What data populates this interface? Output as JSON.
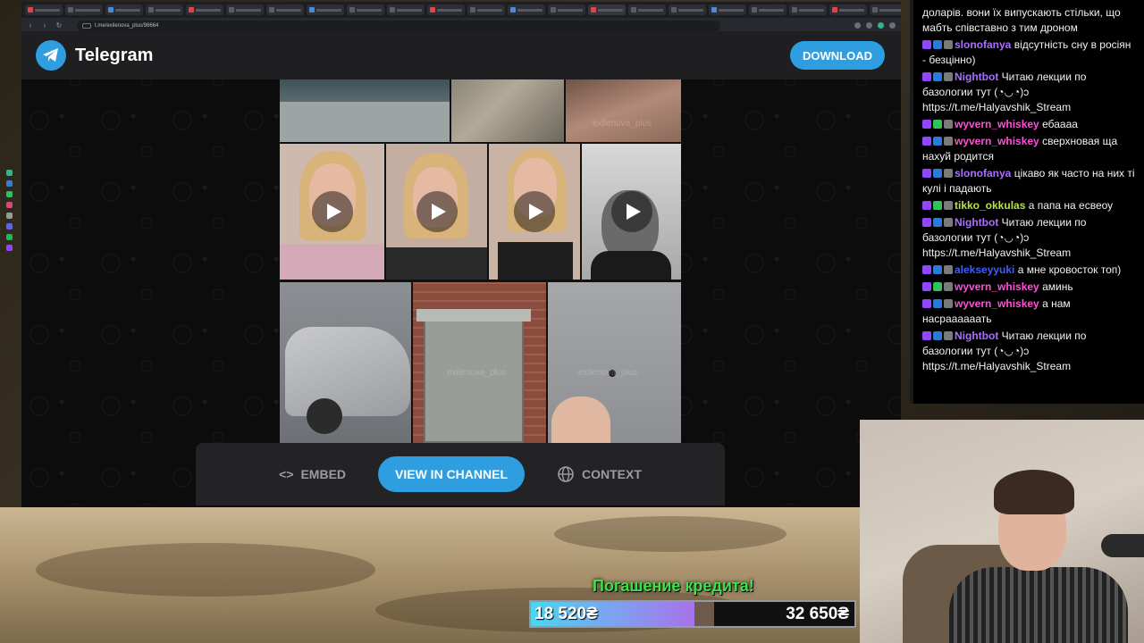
{
  "browser": {
    "url": "t.me/exilenova_plus/98664",
    "tab_count": 30
  },
  "telegram": {
    "brand": "Telegram",
    "download_label": "DOWNLOAD",
    "watermark": "exilenova_plus",
    "actions": {
      "embed_label": "EMBED",
      "view_label": "VIEW IN CHANNEL",
      "context_label": "CONTEXT"
    }
  },
  "chat": {
    "messages": [
      {
        "user": "",
        "color": "#ffffff",
        "text": "доларів. вони їх випускають стільки, що мабть співставно з тим дроном"
      },
      {
        "user": "slonofanya",
        "color": "#a970ff",
        "text": "відсутність сну в росіян - безцінно)"
      },
      {
        "user": "Nightbot",
        "color": "#a970ff",
        "text": "Читаю лекции по базологии тут (◔◡◔)ɔ https://t.me/Halyavshik_Stream"
      },
      {
        "user": "wyvern_whiskey",
        "color": "#ff4fd8",
        "text": "ебаааа"
      },
      {
        "user": "wyvern_whiskey",
        "color": "#ff4fd8",
        "text": "сверхновая ща нахуй родится"
      },
      {
        "user": "slonofanya",
        "color": "#a970ff",
        "text": "цікаво як часто на них ті кулі і падають"
      },
      {
        "user": "tikko_okkulas",
        "color": "#b7e34a",
        "text": "а папа на есвеоу"
      },
      {
        "user": "Nightbot",
        "color": "#a970ff",
        "text": "Читаю лекции по базологии тут (◔◡◔)ɔ https://t.me/Halyavshik_Stream"
      },
      {
        "user": "alekseyyuki",
        "color": "#3f5cff",
        "text": "а мне кровосток топ)"
      },
      {
        "user": "wyvern_whiskey",
        "color": "#ff4fd8",
        "text": "аминь"
      },
      {
        "user": "wyvern_whiskey",
        "color": "#ff4fd8",
        "text": "а нам насраааааать"
      },
      {
        "user": "Nightbot",
        "color": "#a970ff",
        "text": "Читаю лекции по базологии тут (◔◡◔)ɔ https://t.me/Halyavshik_Stream"
      }
    ]
  },
  "donation": {
    "title": "Погашение кредита!",
    "current": "18 520₴",
    "goal": "32 650₴",
    "progress": 0.567
  }
}
